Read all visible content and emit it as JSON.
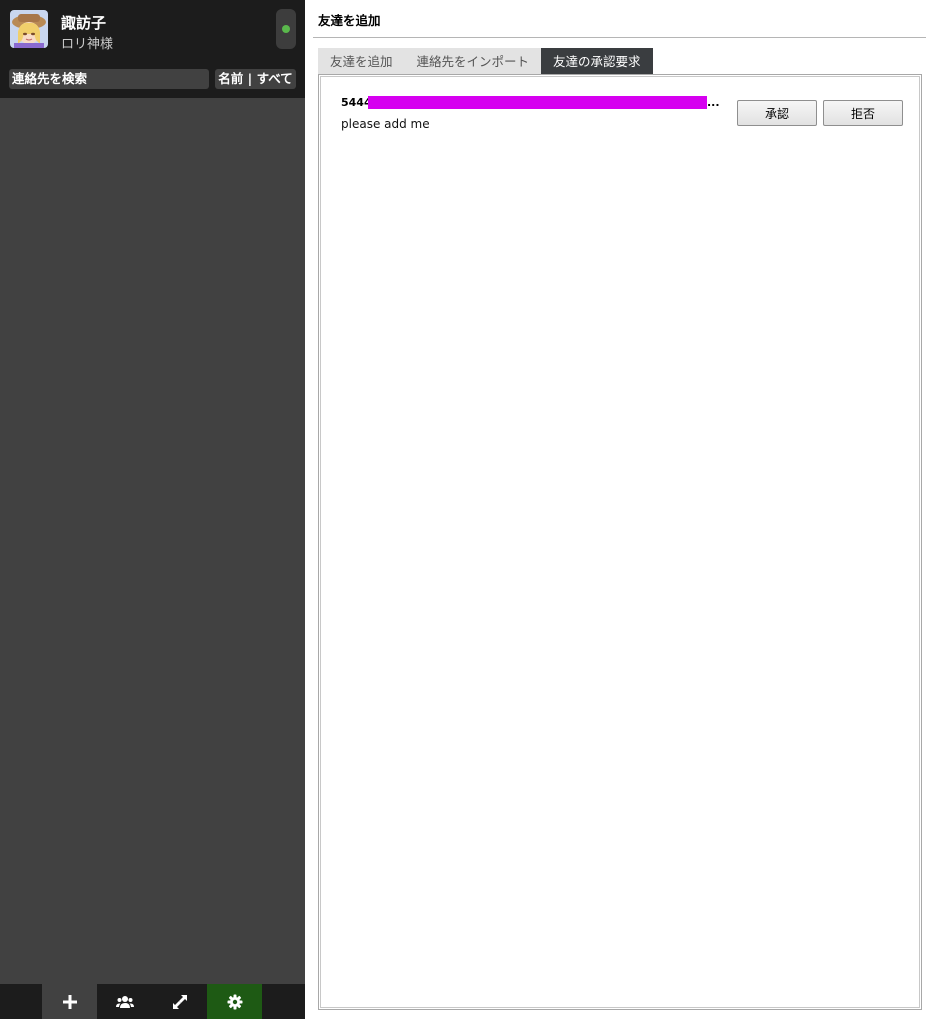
{
  "profile": {
    "name": "諏訪子",
    "status_message": "ロリ神様",
    "online_status_color": "#5ab84c"
  },
  "search": {
    "placeholder": "連絡先を検索",
    "sort_filter_label": "名前 | すべて"
  },
  "bottom_bar": {
    "buttons": [
      {
        "name": "add",
        "icon": "plus-icon"
      },
      {
        "name": "groups",
        "icon": "group-icon"
      },
      {
        "name": "file-transfers",
        "icon": "transfer-arrows-icon"
      },
      {
        "name": "settings",
        "icon": "gear-icon",
        "active": true
      }
    ]
  },
  "main": {
    "title": "友達を追加",
    "tabs": [
      {
        "label": "友達を追加",
        "active": false
      },
      {
        "label": "連絡先をインポート",
        "active": false
      },
      {
        "label": "友達の承認要求",
        "active": true
      }
    ],
    "requests": [
      {
        "id_prefix": "5444",
        "id_redaction_color": "#d600f0",
        "id_ellipsis": "...",
        "message": "please add me",
        "accept_label": "承認",
        "reject_label": "拒否"
      }
    ]
  },
  "colors": {
    "sidebar_bg": "#414141",
    "sidebar_header_bg": "#1c1c1c",
    "settings_active": "#1e5a14",
    "active_tab": "#3a3d40"
  }
}
